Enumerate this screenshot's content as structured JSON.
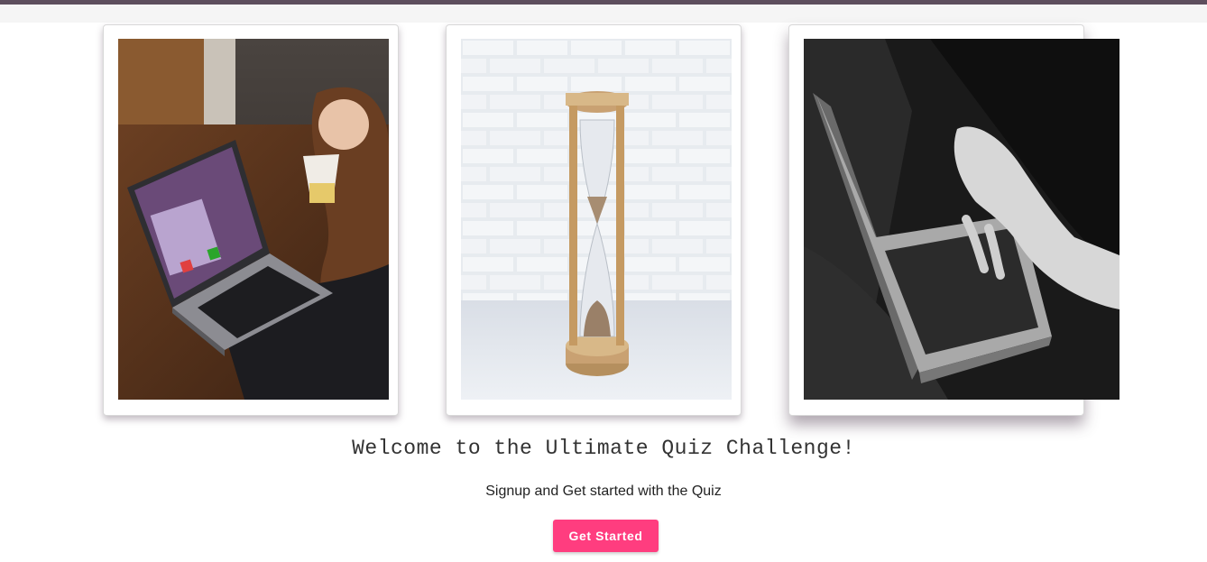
{
  "hero": {
    "images": [
      {
        "name": "girl-on-laptop-quiz-photo"
      },
      {
        "name": "hourglass-photo"
      },
      {
        "name": "hands-on-laptop-bw-photo"
      }
    ],
    "headline": "Welcome to the Ultimate Quiz Challenge!",
    "subtitle": "Signup and Get started with the Quiz",
    "cta_label": "Get Started"
  },
  "colors": {
    "topbar": "#5d4e5d",
    "cta": "#ff3d7f"
  }
}
